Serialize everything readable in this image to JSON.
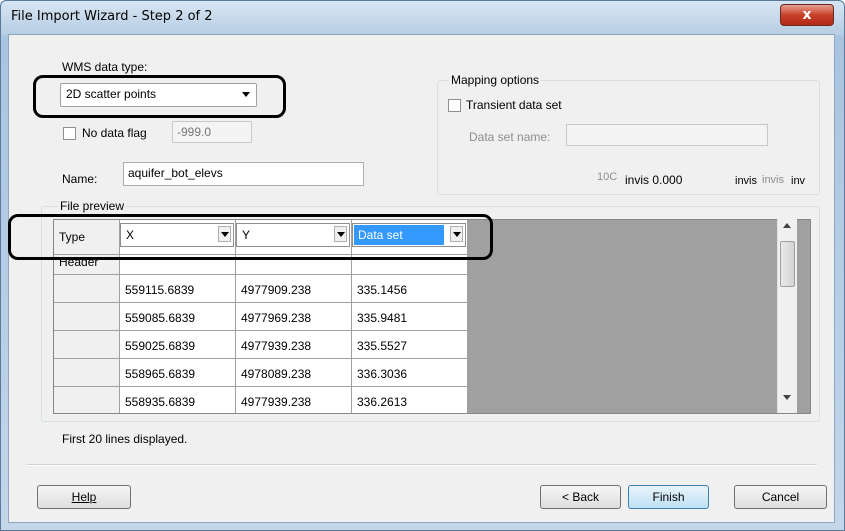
{
  "window": {
    "title": "File Import Wizard - Step 2 of 2",
    "close_glyph": "x"
  },
  "wms": {
    "label": "WMS data type:",
    "selected": "2D scatter points"
  },
  "no_data": {
    "label": "No data flag",
    "value": "-999.0",
    "checked": false
  },
  "name": {
    "label": "Name:",
    "value": "aquifer_bot_elevs"
  },
  "mapping": {
    "title": "Mapping options",
    "transient_label": "Transient data set",
    "transient_checked": false,
    "dataset_name_label": "Data set name:",
    "dataset_name_value": "",
    "trunc_text": "10C",
    "invis1": "invis 0.000",
    "invis2": "invis",
    "invis3": "invis",
    "invis4": "inv"
  },
  "preview": {
    "title": "File preview",
    "row_type_label": "Type",
    "row_header_label": "Header",
    "col_types": [
      "X",
      "Y",
      "Data set"
    ],
    "rows": [
      [
        "559115.6839",
        "4977909.238",
        "335.1456"
      ],
      [
        "559085.6839",
        "4977969.238",
        "335.9481"
      ],
      [
        "559025.6839",
        "4977939.238",
        "335.5527"
      ],
      [
        "558965.6839",
        "4978089.238",
        "336.3036"
      ],
      [
        "558935.6839",
        "4977939.238",
        "336.2613"
      ]
    ],
    "lines_note": "First 20 lines displayed."
  },
  "buttons": {
    "help": "Help",
    "back": "< Back",
    "finish": "Finish",
    "cancel": "Cancel"
  },
  "colors": {
    "selected_cell": "#3399ff",
    "grid_bg": "#a0a0a0",
    "title_bar": "#b7cde3"
  }
}
